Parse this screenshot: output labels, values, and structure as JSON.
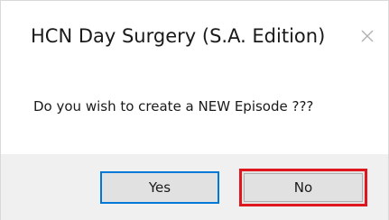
{
  "dialog": {
    "title": "HCN Day Surgery (S.A. Edition)",
    "message": "Do you wish to create a NEW Episode ???",
    "close_icon": "close-icon",
    "buttons": {
      "yes_label": "Yes",
      "no_label": "No"
    },
    "colors": {
      "footer_background": "#f0f0f0",
      "button_background": "#e1e1e1",
      "default_button_border": "#0078d7",
      "highlight_border": "#e0161f"
    }
  }
}
